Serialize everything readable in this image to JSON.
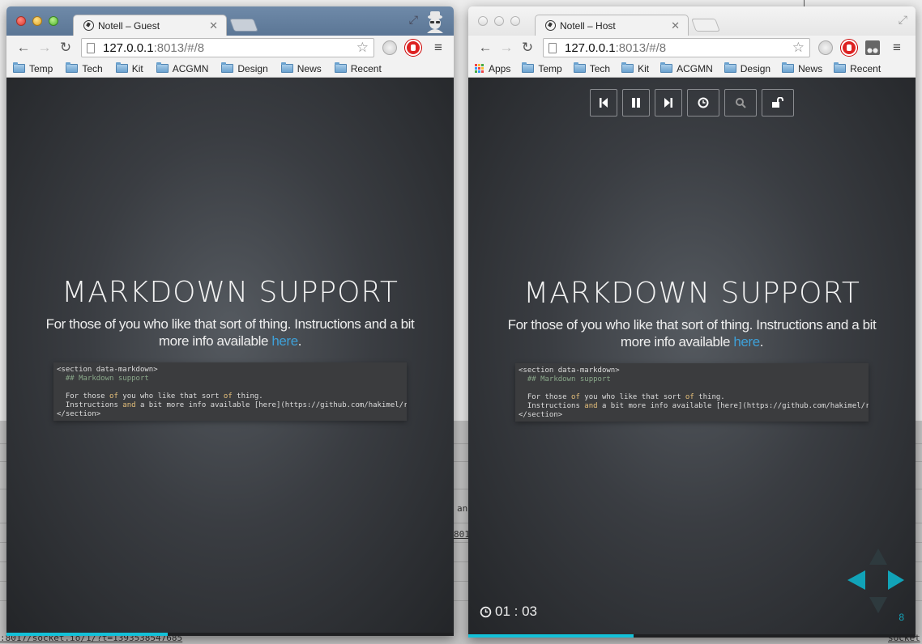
{
  "background": {
    "devtools_url": ":8017/socket.io/1/?t=1393538547685",
    "snippets": [
      "an",
      "801",
      "socket"
    ]
  },
  "guest": {
    "tab_title": "Notell – Guest",
    "url_host": "127.0.0.1",
    "url_rest": ":8013/#/8",
    "bookmarks": [
      "Temp",
      "Tech",
      "Kit",
      "ACGMN",
      "Design",
      "News",
      "Recent"
    ],
    "progress": 0.36
  },
  "host": {
    "tab_title": "Notell – Host",
    "url_host": "127.0.0.1",
    "url_rest": ":8013/#/8",
    "apps_label": "Apps",
    "bookmarks": [
      "Temp",
      "Tech",
      "Kit",
      "ACGMN",
      "Design",
      "News",
      "Recent"
    ],
    "controls": [
      "previous",
      "pause",
      "next",
      "timer",
      "search",
      "unlock"
    ],
    "timer": "01 : 03",
    "slide_number": "8",
    "progress": 0.37,
    "nav_arrows": {
      "left": "enabled",
      "right": "enabled",
      "up": "disabled",
      "down": "disabled"
    }
  },
  "slide": {
    "title": "MARKDOWN SUPPORT",
    "text_before_link": "For those of you who like that sort of thing. Instructions and a bit more info available ",
    "link_text": "here",
    "text_after_link": ".",
    "code": {
      "line1": "<section data-markdown>",
      "line2": "  ## Markdown support",
      "line4_a": "  For those ",
      "line4_kw1": "of",
      "line4_b": " you who like that sort ",
      "line4_kw2": "of",
      "line4_c": " thing.",
      "line5_a": "  Instructions ",
      "line5_kw": "and",
      "line5_b": " a bit more info available [here](https://github.com/hakimel/rev",
      "line6": "</section>"
    }
  },
  "colors": {
    "accent": "#13c1d8",
    "link": "#3ea0d8",
    "nav_arrow": "#11a3b8"
  }
}
